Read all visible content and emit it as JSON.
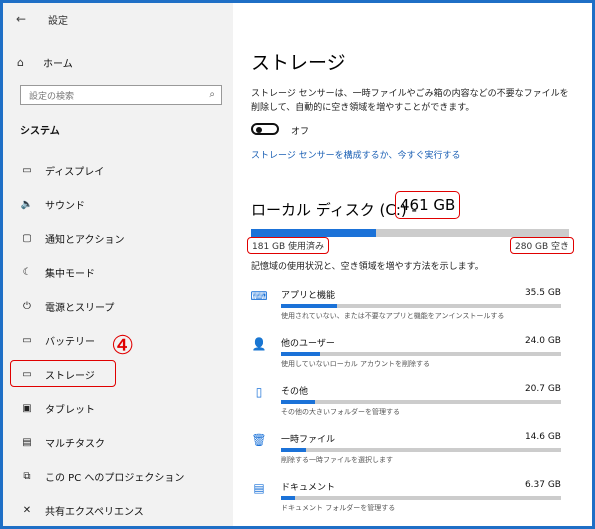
{
  "window": {
    "back_icon": "back-arrow-icon",
    "title": "設定"
  },
  "sidebar": {
    "home_label": "ホーム",
    "search_placeholder": "設定の検索",
    "section_title": "システム",
    "items": [
      {
        "label": "ディスプレイ",
        "icon": "display-icon"
      },
      {
        "label": "サウンド",
        "icon": "speaker-icon"
      },
      {
        "label": "通知とアクション",
        "icon": "notification-icon"
      },
      {
        "label": "集中モード",
        "icon": "moon-icon"
      },
      {
        "label": "電源とスリープ",
        "icon": "power-icon"
      },
      {
        "label": "バッテリー",
        "icon": "battery-icon"
      },
      {
        "label": "ストレージ",
        "icon": "storage-icon"
      },
      {
        "label": "タブレット",
        "icon": "tablet-icon"
      },
      {
        "label": "マルチタスク",
        "icon": "multitask-icon"
      },
      {
        "label": "この PC へのプロジェクション",
        "icon": "projection-icon"
      },
      {
        "label": "共有エクスペリエンス",
        "icon": "shared-icon"
      }
    ],
    "active_index": 6,
    "annotation_number": "④",
    "annotation_color": "#e00000"
  },
  "main": {
    "title": "ストレージ",
    "description": "ストレージ センサーは、一時ファイルやごみ箱の内容などの不要なファイルを削除して、自動的に空き領域を増やすことができます。",
    "toggle_state": "オフ",
    "configure_link": "ストレージ センサーを構成するか、今すぐ実行する",
    "disk_title": "ローカル ディスク (C:) -",
    "disk_size": "461 GB",
    "used_label": "181 GB 使用済み",
    "free_label": "280 GB 空き",
    "used_fraction": 0.393,
    "hint": "記憶域の使用状況と、空き領域を増やす方法を示します。",
    "categories": [
      {
        "name": "アプリと機能",
        "size": "35.5 GB",
        "desc": "使用されていない、または不要なアプリと機能をアンインストールする",
        "icon": "keyboard-icon",
        "fraction": 0.2
      },
      {
        "name": "他のユーザー",
        "size": "24.0 GB",
        "desc": "使用していないローカル アカウントを削除する",
        "icon": "users-icon",
        "fraction": 0.14
      },
      {
        "name": "その他",
        "size": "20.7 GB",
        "desc": "その他の大きいフォルダーを管理する",
        "icon": "files-icon",
        "fraction": 0.12
      },
      {
        "name": "一時ファイル",
        "size": "14.6 GB",
        "desc": "削除する一時ファイルを選択します",
        "icon": "trash-icon",
        "fraction": 0.09
      },
      {
        "name": "ドキュメント",
        "size": "6.37 GB",
        "desc": "ドキュメント フォルダーを管理する",
        "icon": "folder-icon",
        "fraction": 0.05
      }
    ]
  },
  "colors": {
    "accent": "#1b72d8",
    "highlight": "#e00000",
    "frame": "#1f6fc6"
  }
}
